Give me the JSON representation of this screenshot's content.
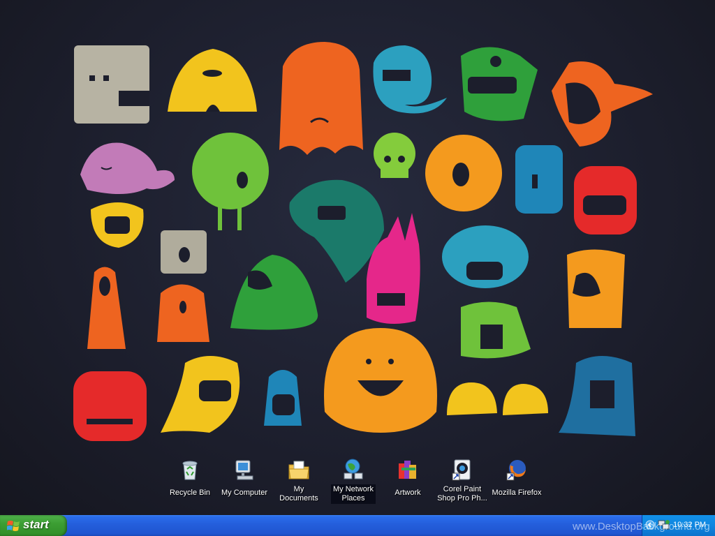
{
  "desktop_icons": [
    {
      "label": "Recycle Bin",
      "icon": "recycle-bin-icon"
    },
    {
      "label": "My Computer",
      "icon": "my-computer-icon"
    },
    {
      "label": "My Documents",
      "icon": "my-documents-icon"
    },
    {
      "label": "My Network Places",
      "icon": "network-places-icon"
    },
    {
      "label": "Artwork",
      "icon": "artwork-icon"
    },
    {
      "label": "Corel Paint Shop Pro Ph...",
      "icon": "corel-paint-shop-icon"
    },
    {
      "label": "Mozilla Firefox",
      "icon": "firefox-icon"
    }
  ],
  "taskbar": {
    "start_label": "start",
    "clock": "10:32 PM",
    "color": "#245edb",
    "start_color": "#3c9e33"
  },
  "watermark": "www.DesktopBackground.org"
}
